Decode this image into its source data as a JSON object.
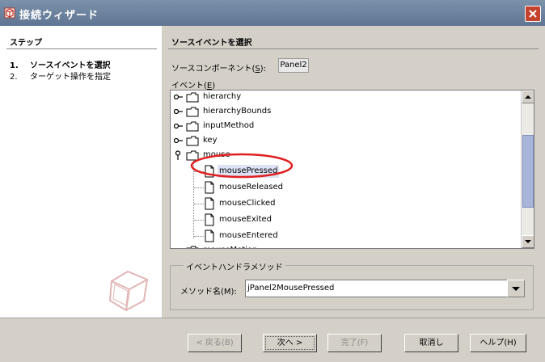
{
  "window": {
    "title": "接続ウィザード",
    "colors": {
      "titlebar": "#6e84a0",
      "close": "#c4432e",
      "highlight": "#dde3f5",
      "annotation": "#e02020"
    }
  },
  "steps": {
    "header": "ステップ",
    "items": [
      {
        "num": "1.",
        "label": "ソースイベントを選択"
      },
      {
        "num": "2.",
        "label": "ターゲット操作を指定"
      }
    ]
  },
  "content": {
    "title": "ソースイベントを選択",
    "source_label": "ソースコンポーネント(",
    "source_mnemonic": "S",
    "source_label_end": "):",
    "source_value": "Panel2",
    "event_label": "イベント(",
    "event_mnemonic": "E",
    "event_label_end": ")"
  },
  "tree": {
    "rows": [
      {
        "label": "hierarchy",
        "type": "folder",
        "expanded": false
      },
      {
        "label": "hierarchyBounds",
        "type": "folder",
        "expanded": false
      },
      {
        "label": "inputMethod",
        "type": "folder",
        "expanded": false
      },
      {
        "label": "key",
        "type": "folder",
        "expanded": false
      },
      {
        "label": "mouse",
        "type": "folder",
        "expanded": true
      },
      {
        "label": "mousePressed",
        "type": "leaf",
        "selected": true
      },
      {
        "label": "mouseReleased",
        "type": "leaf"
      },
      {
        "label": "mouseClicked",
        "type": "leaf"
      },
      {
        "label": "mouseExited",
        "type": "leaf"
      },
      {
        "label": "mouseEntered",
        "type": "leaf"
      },
      {
        "label": "mouseMotion",
        "type": "folder",
        "expanded": false
      }
    ]
  },
  "handler": {
    "group_title": "イベントハンドラメソッド",
    "method_label": "メソッド名(M):",
    "method_value": "jPanel2MousePressed"
  },
  "buttons": {
    "back": "< 戻る(B)",
    "next": "次へ >",
    "finish": "完了(F)",
    "cancel": "取消し",
    "help": "ヘルプ(H)"
  }
}
